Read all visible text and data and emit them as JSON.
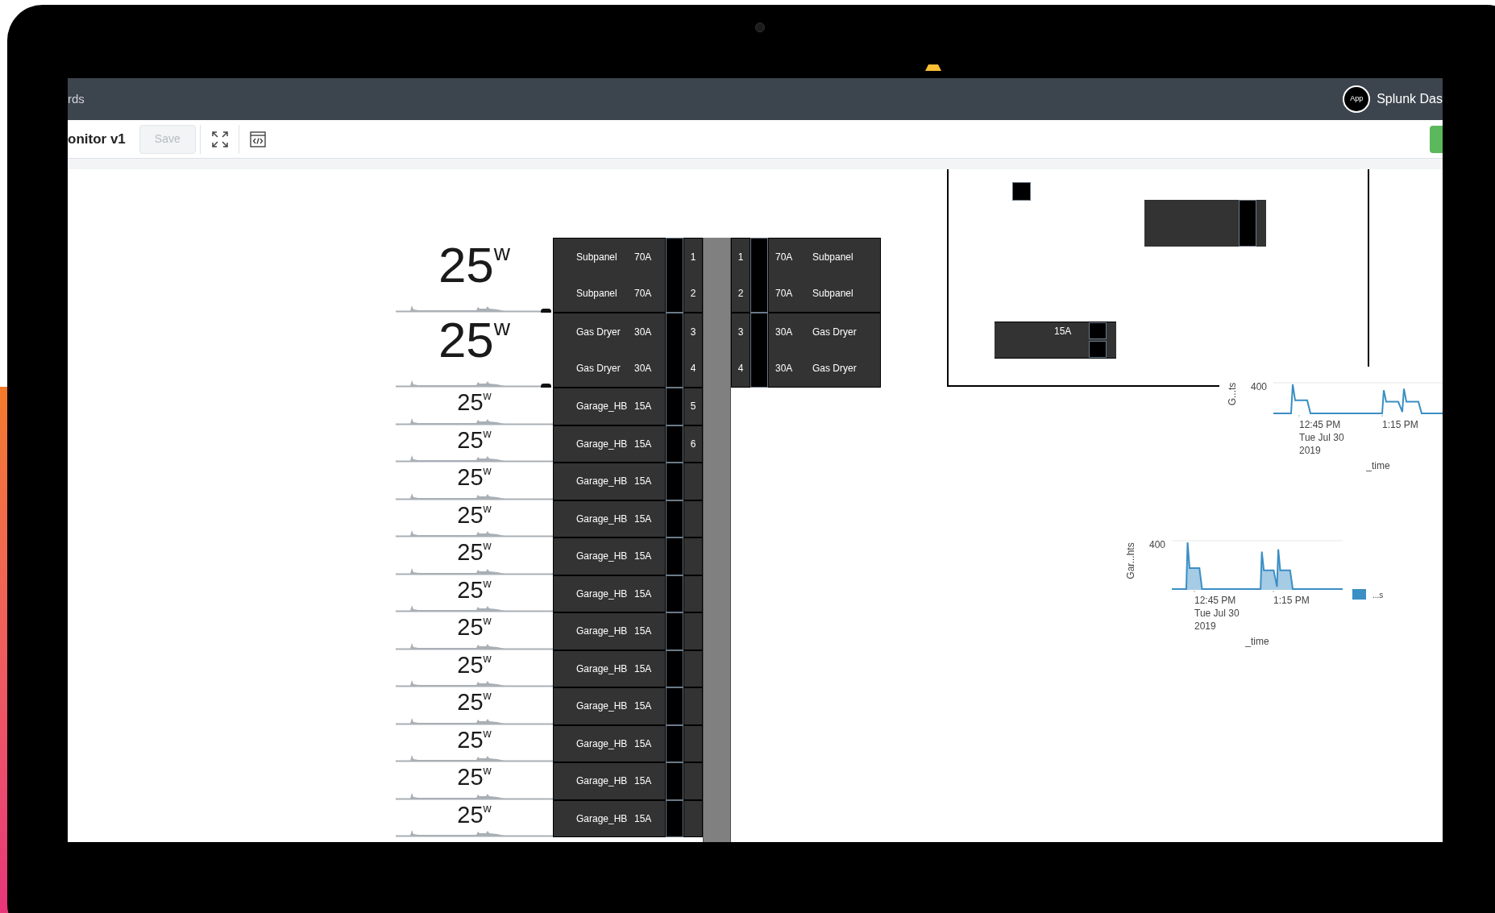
{
  "nav": {
    "left_text": "rds",
    "app_icon": "App",
    "app_title": "Splunk Das"
  },
  "toolbar": {
    "title": "onitor v1",
    "save": {
      "label": "Save",
      "disabled": true
    }
  },
  "circuits": [
    {
      "kind": "large",
      "reading": "25",
      "unit": "w",
      "breakers": [
        {
          "label": "Subpanel",
          "amps": "70A",
          "number": "1"
        },
        {
          "label": "Subpanel",
          "amps": "70A",
          "number": "2"
        }
      ],
      "mirror": [
        {
          "number": "1",
          "amps": "70A",
          "label": "Subpanel"
        },
        {
          "number": "2",
          "amps": "70A",
          "label": "Subpanel"
        }
      ]
    },
    {
      "kind": "large",
      "reading": "25",
      "unit": "w",
      "breakers": [
        {
          "label": "Gas Dryer",
          "amps": "30A",
          "number": "3"
        },
        {
          "label": "Gas Dryer",
          "amps": "30A",
          "number": "4"
        }
      ],
      "mirror": [
        {
          "number": "3",
          "amps": "30A",
          "label": "Gas Dryer"
        },
        {
          "number": "4",
          "amps": "30A",
          "label": "Gas Dryer"
        }
      ]
    },
    {
      "kind": "small",
      "reading": "25",
      "unit": "w",
      "breakers": [
        {
          "label": "Garage_HB",
          "amps": "15A",
          "number": "5"
        }
      ]
    },
    {
      "kind": "small",
      "reading": "25",
      "unit": "w",
      "breakers": [
        {
          "label": "Garage_HB",
          "amps": "15A",
          "number": "6"
        }
      ]
    },
    {
      "kind": "small",
      "reading": "25",
      "unit": "w",
      "breakers": [
        {
          "label": "Garage_HB",
          "amps": "15A"
        }
      ]
    },
    {
      "kind": "small",
      "reading": "25",
      "unit": "w",
      "breakers": [
        {
          "label": "Garage_HB",
          "amps": "15A"
        }
      ]
    },
    {
      "kind": "small",
      "reading": "25",
      "unit": "w",
      "breakers": [
        {
          "label": "Garage_HB",
          "amps": "15A"
        }
      ]
    },
    {
      "kind": "small",
      "reading": "25",
      "unit": "w",
      "breakers": [
        {
          "label": "Garage_HB",
          "amps": "15A"
        }
      ]
    },
    {
      "kind": "small",
      "reading": "25",
      "unit": "w",
      "breakers": [
        {
          "label": "Garage_HB",
          "amps": "15A"
        }
      ]
    },
    {
      "kind": "small",
      "reading": "25",
      "unit": "w",
      "breakers": [
        {
          "label": "Garage_HB",
          "amps": "15A"
        }
      ]
    },
    {
      "kind": "small",
      "reading": "25",
      "unit": "w",
      "breakers": [
        {
          "label": "Garage_HB",
          "amps": "15A"
        }
      ]
    },
    {
      "kind": "small",
      "reading": "25",
      "unit": "w",
      "breakers": [
        {
          "label": "Garage_HB",
          "amps": "15A"
        }
      ]
    },
    {
      "kind": "small",
      "reading": "25",
      "unit": "w",
      "breakers": [
        {
          "label": "Garage_HB",
          "amps": "15A"
        }
      ]
    },
    {
      "kind": "small",
      "reading": "25",
      "unit": "w",
      "breakers": [
        {
          "label": "Garage_HB",
          "amps": "15A"
        }
      ]
    }
  ],
  "diagram": {
    "block_label": "15A"
  },
  "charts": [
    {
      "kind": "line",
      "ylabel": "G...ts",
      "ytick": "400",
      "xticks": [
        {
          "lines": [
            "12:45 PM",
            "Tue Jul 30",
            "2019"
          ]
        },
        {
          "lines": [
            "1:15 PM"
          ]
        }
      ],
      "xlabel": "_time"
    },
    {
      "kind": "area",
      "ylabel": "Gar...hts",
      "ytick": "400",
      "xticks": [
        {
          "lines": [
            "12:45 PM",
            "Tue Jul 30",
            "2019"
          ]
        },
        {
          "lines": [
            "1:15 PM"
          ]
        }
      ],
      "xlabel": "_time",
      "legend": "...s"
    }
  ]
}
